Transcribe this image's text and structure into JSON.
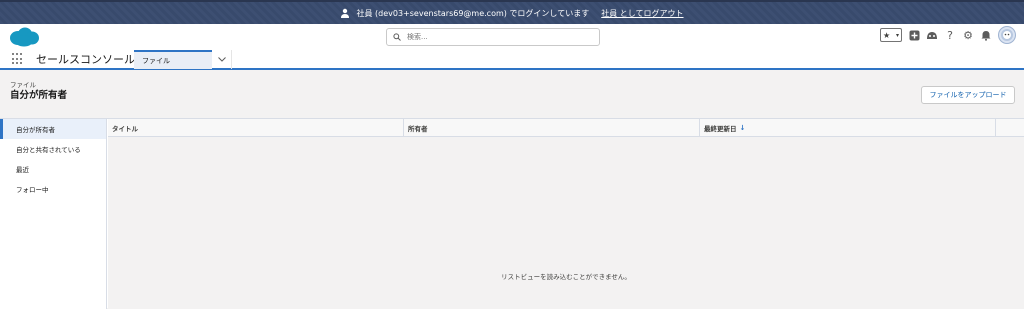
{
  "banner": {
    "message": "社員 (dev03+sevenstars69@me.com) でログインしています",
    "logout_link": "社員 としてログアウト"
  },
  "header": {
    "search_placeholder": "検索..."
  },
  "nav": {
    "app_name": "セールスコンソール",
    "tab_label": "ファイル"
  },
  "page": {
    "subtitle": "ファイル",
    "title": "自分が所有者",
    "upload_button": "ファイルをアップロード"
  },
  "sidebar": {
    "items": [
      {
        "label": "自分が所有者"
      },
      {
        "label": "自分と共有されている"
      },
      {
        "label": "最近"
      },
      {
        "label": "フォロー中"
      }
    ]
  },
  "table": {
    "columns": [
      "タイトル",
      "所有者",
      "最終更新日"
    ],
    "sort_indicator": "↓",
    "empty_message": "リストビューを読み込むことができません。"
  },
  "colors": {
    "brand": "#2e74c5",
    "banner_bg": "#3d4f72",
    "link": "#0b5cab"
  }
}
